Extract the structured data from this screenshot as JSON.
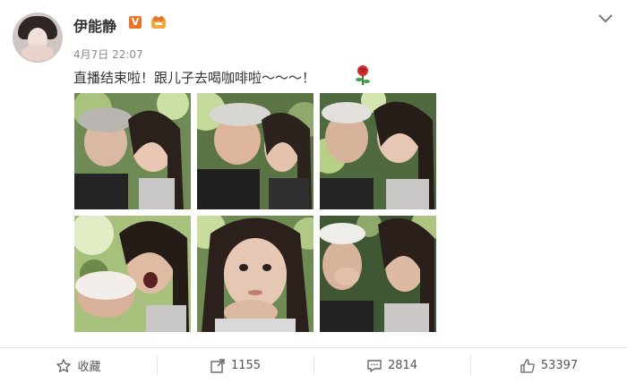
{
  "post": {
    "author_name": "伊能静",
    "timestamp": "4月7日 22:07",
    "text": "直播结束啦！跟儿子去喝咖啡啦～～～！",
    "verified_badge_label": "V",
    "accent_color": "#e8742c",
    "emoji": "rose-icon",
    "photos": [
      {
        "label": "photo-1"
      },
      {
        "label": "photo-2"
      },
      {
        "label": "photo-3"
      },
      {
        "label": "photo-4"
      },
      {
        "label": "photo-5"
      },
      {
        "label": "photo-6"
      }
    ]
  },
  "actions": {
    "favorite_label": "收藏",
    "repost_count": "1155",
    "comment_count": "2814",
    "like_count": "53397"
  }
}
